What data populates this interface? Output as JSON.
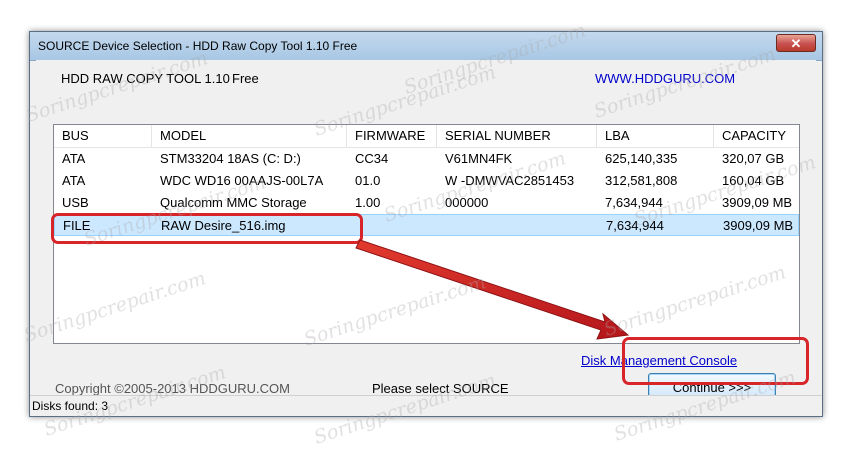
{
  "window": {
    "title": "SOURCE Device Selection - HDD Raw Copy Tool 1.10   Free",
    "close_icon": "close-icon"
  },
  "header": {
    "app_name": "HDD RAW COPY TOOL 1.10",
    "free_label": "Free",
    "website": "WWW.HDDGURU.COM"
  },
  "device_table": {
    "columns": [
      "BUS",
      "MODEL",
      "FIRMWARE",
      "SERIAL NUMBER",
      "LBA",
      "CAPACITY"
    ],
    "rows": [
      {
        "bus": "ATA",
        "model": "STM33204 18AS (C: D:)",
        "firmware": "CC34",
        "serial": "V61MN4FK",
        "lba": "625,140,335",
        "capacity": "320,07 GB"
      },
      {
        "bus": "ATA",
        "model": "WDC WD16 00AAJS-00L7A",
        "firmware": "01.0",
        "serial": "W -DMWVAC2851453",
        "lba": "312,581,808",
        "capacity": "160,04 GB"
      },
      {
        "bus": "USB",
        "model": "Qualcomm MMC Storage",
        "firmware": "1.00",
        "serial": "000000",
        "lba": "7,634,944",
        "capacity": "3909,09 MB"
      },
      {
        "bus": "FILE",
        "model": "RAW Desire_516.img",
        "firmware": "",
        "serial": "",
        "lba": "7,634,944",
        "capacity": "3909,09 MB"
      }
    ],
    "selected_row_index": 3
  },
  "footer": {
    "copyright": "Copyright ©2005-2013 HDDGURU.COM",
    "status_message": "Please select SOURCE",
    "disk_management_link": "Disk Management Console",
    "continue_label": "Continue >>>"
  },
  "statusbar": {
    "disks_found": "Disks found: 3"
  },
  "annotation": {
    "highlight_color": "#d7252a"
  },
  "watermark_text": "Soringpcrepair.com"
}
